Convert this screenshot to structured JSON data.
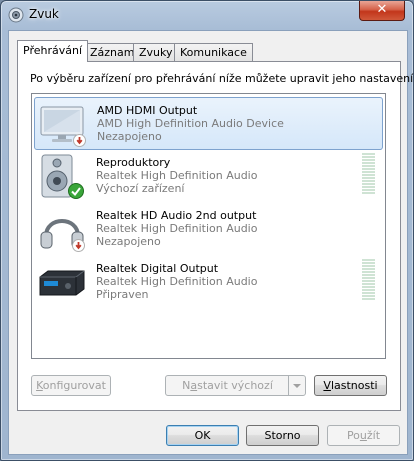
{
  "window": {
    "title": "Zvuk",
    "close_label": "✕"
  },
  "tabs": [
    {
      "label": "Přehrávání",
      "active": true
    },
    {
      "label": "Záznam",
      "active": false
    },
    {
      "label": "Zvuky",
      "active": false
    },
    {
      "label": "Komunikace",
      "active": false
    }
  ],
  "instruction": "Po výběru zařízení pro přehrávání níže můžete upravit jeho nastavení:",
  "devices": [
    {
      "name": "AMD HDMI Output",
      "description": "AMD High Definition Audio Device",
      "status": "Nezapojeno",
      "icon": "monitor-icon",
      "badge": "unplugged-badge-icon",
      "selected": true,
      "meter": false
    },
    {
      "name": "Reproduktory",
      "description": "Realtek High Definition Audio",
      "status": "Výchozí zařízení",
      "icon": "speaker-icon",
      "badge": "default-check-badge-icon",
      "selected": false,
      "meter": true
    },
    {
      "name": "Realtek HD Audio 2nd output",
      "description": "Realtek High Definition Audio",
      "status": "Nezapojeno",
      "icon": "headphones-icon",
      "badge": "unplugged-badge-icon",
      "selected": false,
      "meter": false
    },
    {
      "name": "Realtek Digital Output",
      "description": "Realtek High Definition Audio",
      "status": "Připraven",
      "icon": "digital-receiver-icon",
      "badge": "",
      "selected": false,
      "meter": true
    }
  ],
  "buttons": {
    "configure": {
      "label": "Konfigurovat",
      "mnemonic": "K",
      "enabled": false
    },
    "set_default": {
      "label": "Nastavit výchozí",
      "mnemonic": "a",
      "enabled": false
    },
    "properties": {
      "label": "Vlastnosti",
      "mnemonic": "V",
      "enabled": true
    },
    "ok": {
      "label": "OK",
      "enabled": true
    },
    "cancel": {
      "label": "Storno",
      "enabled": true
    },
    "apply": {
      "label": "Použít",
      "mnemonic": "P",
      "enabled": false
    }
  },
  "colors": {
    "selection": "#d5e7f9",
    "meter_off": "#cfe3d4",
    "check_badge": "#3aa63a",
    "unplugged_badge": "#c0392b"
  }
}
